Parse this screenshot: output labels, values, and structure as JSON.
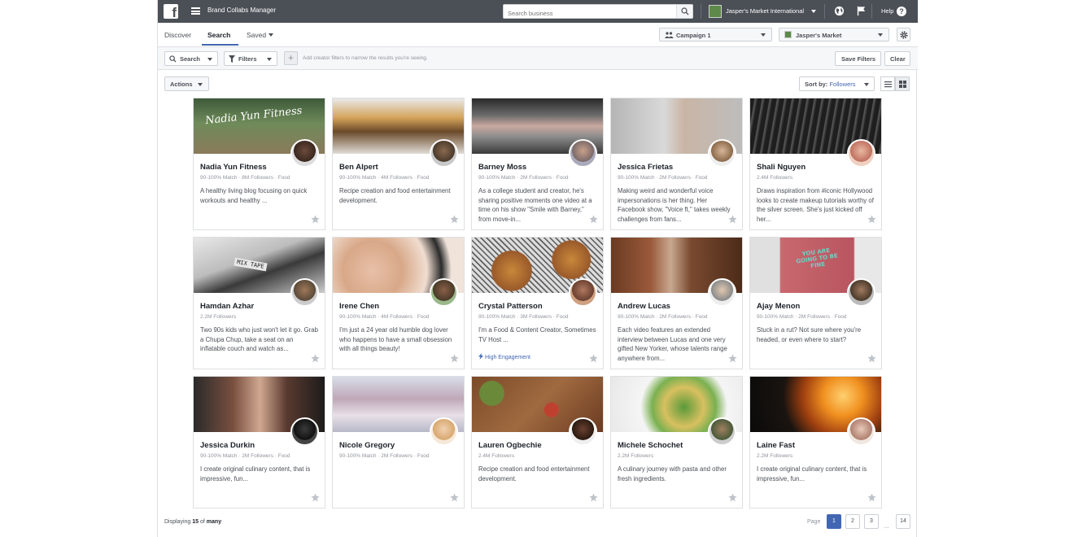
{
  "topbar": {
    "logo": "f",
    "app_title": "Brand Collabs Manager",
    "search_placeholder": "Search business",
    "account_name": "Jasper's Market International",
    "help_label": "Help"
  },
  "nav": {
    "tabs": [
      {
        "label": "Discover"
      },
      {
        "label": "Search"
      },
      {
        "label": "Saved"
      }
    ],
    "active_tab": "Search",
    "campaign_select": "Campaign 1",
    "page_select": "Jasper's Market"
  },
  "filters": {
    "search_label": "Search",
    "filters_label": "Filters",
    "hint": "Add creator filters to narrow the results you're seeing.",
    "save_filters_label": "Save Filters",
    "clear_label": "Clear"
  },
  "toolbar": {
    "actions_label": "Actions",
    "sort_prefix": "Sort by:",
    "sort_value": "Followers"
  },
  "creators": [
    {
      "name": "Nadia Yun Fitness",
      "meta": "90-100% Match · 8M Followers · Food",
      "desc": "A healthy living blog focusing on quick workouts and healthy ...",
      "badge": "",
      "cover_overlay": "Nadia Yun Fitness"
    },
    {
      "name": "Ben Alpert",
      "meta": "90-100% Match · 4M Followers · Food",
      "desc": "Recipe creation and food entertainment development.",
      "badge": ""
    },
    {
      "name": "Barney Moss",
      "meta": "90-100% Match · 2M Followers · Food",
      "desc": "As a college student and creator, he's sharing positive moments one video at a time on his show \"Smile with Barney,\" from move-in...",
      "badge": ""
    },
    {
      "name": "Jessica Frietas",
      "meta": "90-100% Match · 2M Followers · Food",
      "desc": "Making weird and wonderful voice impersonations is her thing. Her Facebook show, \"Voice ft,\" takes weekly challenges from fans...",
      "badge": ""
    },
    {
      "name": "Shali Nguyen",
      "meta": "2.4M Followers",
      "desc": "Draws inspiration from #iconic Hollywood looks to create makeup tutorials worthy of the silver screen. She's just kicked off her...",
      "badge": ""
    },
    {
      "name": "Hamdan Azhar",
      "meta": "2.2M Followers",
      "desc": "Two 90s kids who just won't let it go. Grab a Chupa Chup, take a seat on an inflatable couch and watch as...",
      "badge": "",
      "cover_overlay": "MIX TAPE"
    },
    {
      "name": "Irene Chen",
      "meta": "90-100% Match · 4M Followers · Food",
      "desc": "I'm just a 24 year old humble dog lover who happens to have a small obsession with all things beauty!",
      "badge": ""
    },
    {
      "name": "Crystal Patterson",
      "meta": "90-100% Match · 3M Followers · Food",
      "desc": "I'm a Food & Content Creator, Sometimes TV Host ...",
      "badge": "High Engagement"
    },
    {
      "name": "Andrew Lucas",
      "meta": "90-100% Match · 2M Followers · Food",
      "desc": "Each video features an extended interview between Lucas and one very gifted New Yorker, whose talents range anywhere from...",
      "badge": ""
    },
    {
      "name": "Ajay Menon",
      "meta": "90-100% Match · 2M Followers · Food",
      "desc": "Stuck in a rut? Not sure where you're headed, or even where to start?",
      "badge": "",
      "cover_overlay": "YOU ARE GOING TO BE FINE"
    },
    {
      "name": "Jessica Durkin",
      "meta": "90-100% Match · 2M Followers · Food",
      "desc": "I create original culinary content, that is impressive, fun...",
      "badge": ""
    },
    {
      "name": "Nicole Gregory",
      "meta": "90-100% Match · 2M Followers · Food",
      "desc": "",
      "badge": ""
    },
    {
      "name": "Lauren Ogbechie",
      "meta": "2.4M Followers",
      "desc": "Recipe creation and food entertainment development.",
      "badge": ""
    },
    {
      "name": "Michele Schochet",
      "meta": "2.2M Followers",
      "desc": "A culinary journey with pasta and other fresh ingredients.",
      "badge": ""
    },
    {
      "name": "Laine Fast",
      "meta": "2.2M Followers",
      "desc": "I create original culinary content, that is impressive, fun...",
      "badge": ""
    }
  ],
  "footer": {
    "displaying_prefix": "Displaying",
    "displaying_count": "15",
    "displaying_of": "of",
    "displaying_total": "many",
    "page_label": "Page",
    "pages": [
      "1",
      "2",
      "3",
      "14"
    ],
    "active_page": "1",
    "ellipsis": "..."
  },
  "colors": {
    "topbar": "#4b4f56",
    "accent": "#4267b2",
    "border": "#dddfe2",
    "muted_text": "#90949c"
  },
  "icons": [
    "facebook-logo-icon",
    "hamburger-menu-icon",
    "search-icon",
    "globe-icon",
    "flag-icon",
    "help-icon",
    "people-icon",
    "gear-icon",
    "funnel-icon",
    "plus-icon",
    "list-view-icon",
    "grid-view-icon",
    "star-icon",
    "lightning-icon"
  ]
}
